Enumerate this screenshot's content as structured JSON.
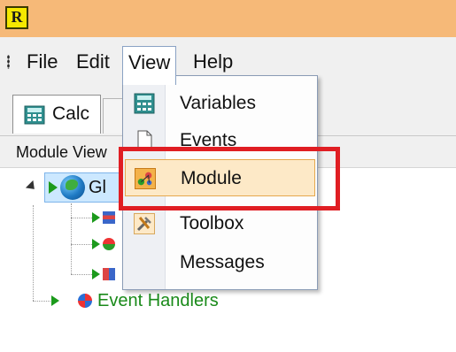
{
  "app": {
    "logo_letter": "R",
    "title_color": "#f6b978"
  },
  "menubar": {
    "file": "File",
    "edit": "Edit",
    "view": "View",
    "help": "Help"
  },
  "tabs": [
    {
      "label": "Calc"
    }
  ],
  "module_view": {
    "header": "Module View",
    "root_label": "Gl",
    "event_handlers_label": "Event Handlers"
  },
  "view_menu": {
    "items": [
      {
        "label": "Variables",
        "icon": "calculator-icon"
      },
      {
        "label": "Events",
        "icon": "page-icon"
      },
      {
        "label": "Module",
        "icon": "module-icon",
        "highlighted": true
      },
      {
        "label": "Toolbox",
        "icon": "tools-icon"
      },
      {
        "label": "Messages",
        "icon": ""
      }
    ]
  },
  "annotation": {
    "highlight_color": "#e01e23"
  }
}
